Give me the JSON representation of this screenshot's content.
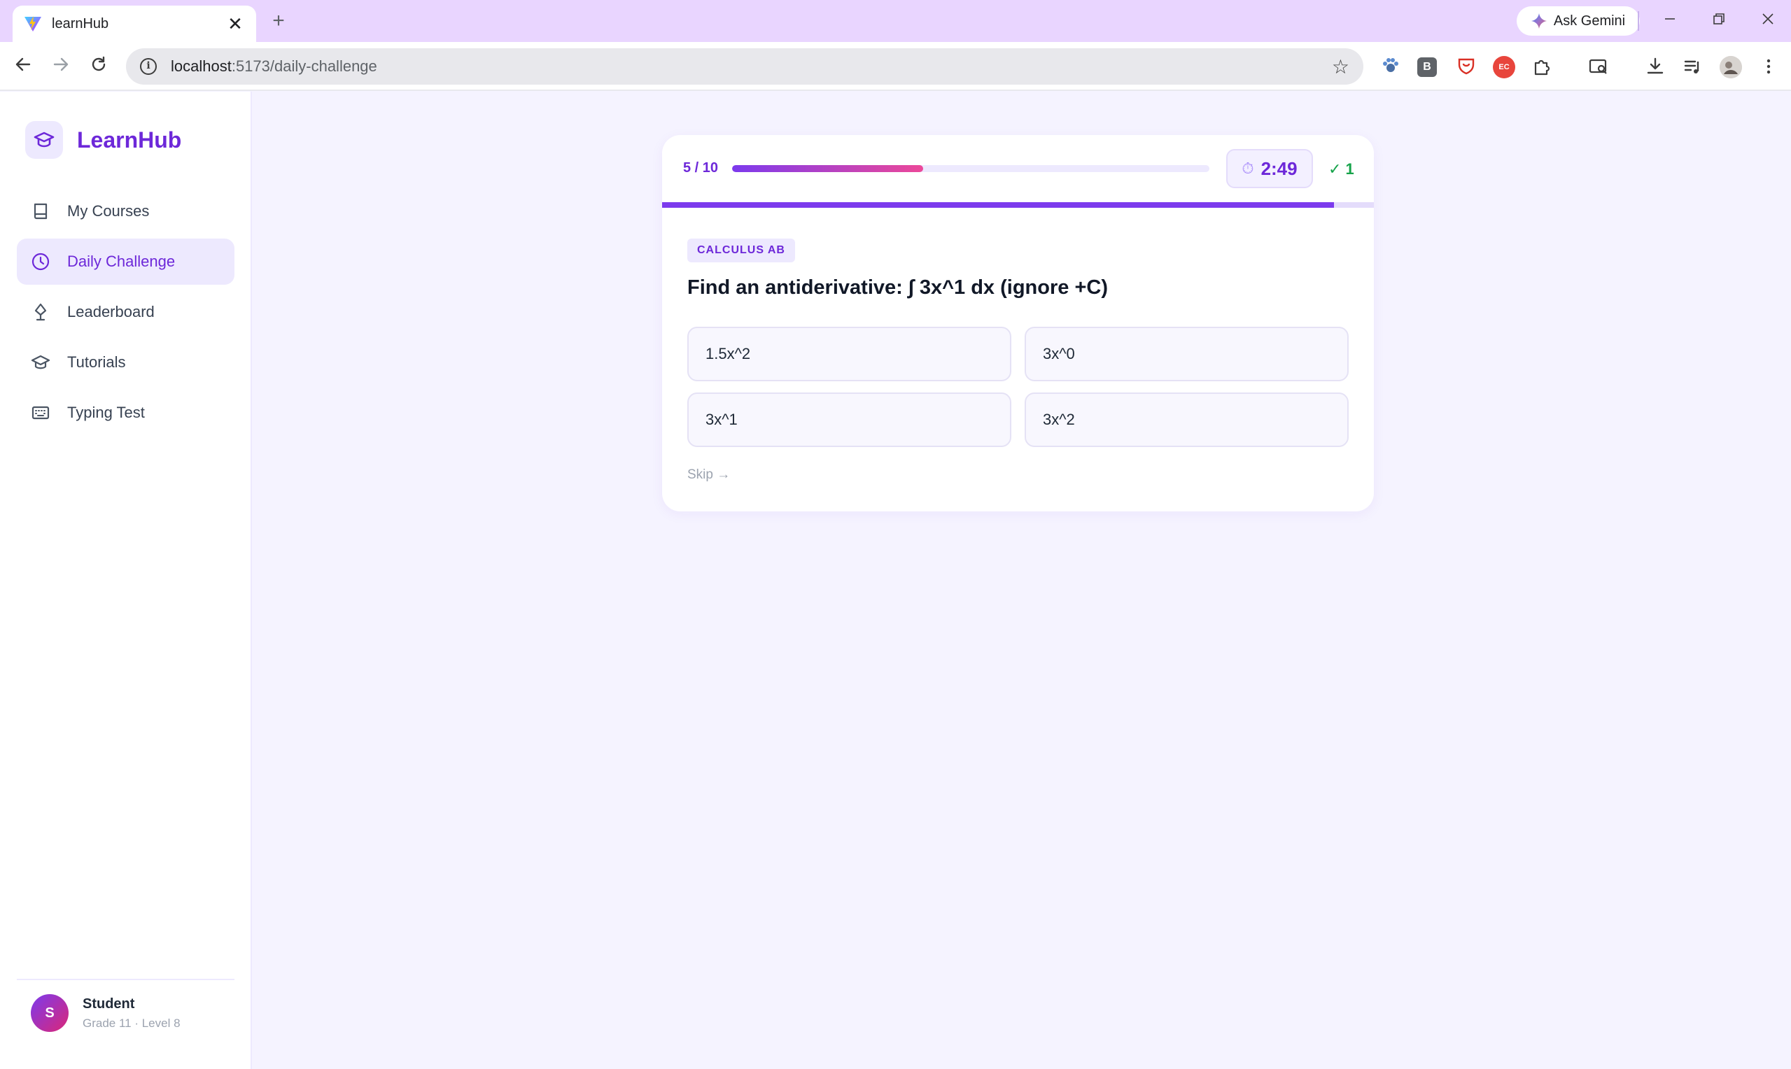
{
  "browser": {
    "tab_title": "learnHub",
    "tab_close": "✕",
    "new_tab": "+",
    "gemini_label": "Ask Gemini",
    "url_host": "localhost",
    "url_path": ":5173/daily-challenge",
    "ext_b_label": "B",
    "ext_c_label": "EC"
  },
  "brand": {
    "name": "LearnHub"
  },
  "nav": {
    "items": [
      {
        "label": "My Courses",
        "icon": "book-icon"
      },
      {
        "label": "Daily Challenge",
        "icon": "clock-icon",
        "active": true
      },
      {
        "label": "Leaderboard",
        "icon": "trophy-icon"
      },
      {
        "label": "Tutorials",
        "icon": "graduation-cap-icon"
      },
      {
        "label": "Typing Test",
        "icon": "keyboard-icon"
      }
    ]
  },
  "user": {
    "initial": "S",
    "name": "Student",
    "meta": "Grade 11 · Level 8"
  },
  "quiz": {
    "counter": "5 / 10",
    "progress_fraction": 0.4,
    "timer": "2:49",
    "time_remaining_fraction": 0.944,
    "score": "✓ 1",
    "subject": "CALCULUS AB",
    "question": "Find an antiderivative: ∫ 3x^1 dx (ignore +C)",
    "options": [
      "1.5x^2",
      "3x^0",
      "3x^1",
      "3x^2"
    ],
    "skip_label": "Skip →"
  },
  "colors": {
    "accent": "#6d28d9",
    "accent_light": "#ede9fe",
    "success": "#16a34a",
    "progress_gradient_end": "#ec4899"
  }
}
